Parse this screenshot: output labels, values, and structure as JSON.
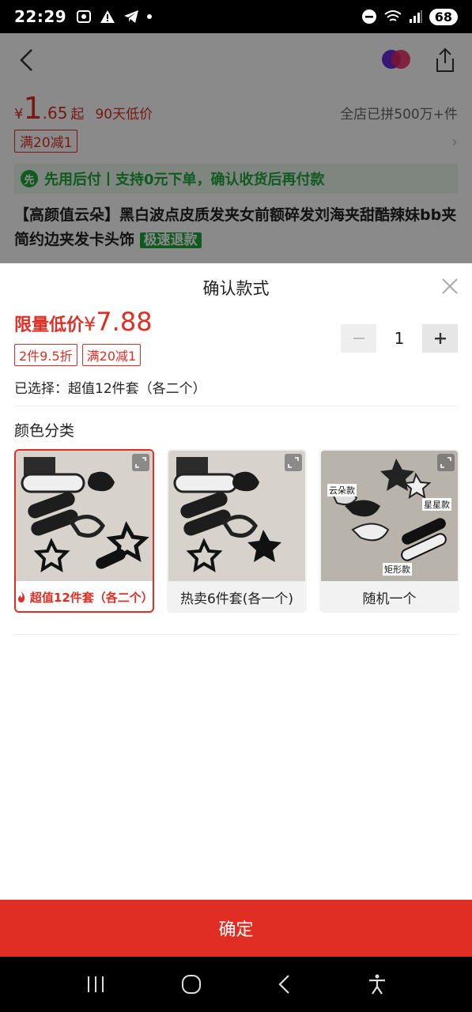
{
  "status": {
    "time": "22:29",
    "battery": "68"
  },
  "background": {
    "price_yen": "¥",
    "price_int": "1",
    "price_dec": ".65",
    "price_suffix": "起",
    "low_price_tag": "90天低价",
    "sold_count": "全店已拼500万+件",
    "coupon": "满20减1",
    "pay_banner": "先用后付丨支持0元下单，确认收货后再付款",
    "product_title": "【高颜值云朵】黑白波点皮质发夹女前额碎发刘海夹甜酷辣妹bb夹简约边夹发卡头饰",
    "fast_refund": "极速退款"
  },
  "sheet": {
    "title": "确认款式",
    "price_label": "限量低价",
    "price_yen": "¥",
    "price_value": "7.88",
    "tags": [
      "2件9.5折",
      "满20减1"
    ],
    "quantity": "1",
    "selected_text": "已选择：超值12件套（各二个）",
    "section_label": "颜色分类",
    "variants": [
      {
        "label": "超值12件套（各二个）",
        "selected": true
      },
      {
        "label": "热卖6件套(各一个)",
        "selected": false
      },
      {
        "label": "随机一个",
        "selected": false
      }
    ],
    "image_overlay_labels": [
      "云朵款",
      "星星款",
      "矩形款"
    ],
    "confirm_label": "确定"
  }
}
